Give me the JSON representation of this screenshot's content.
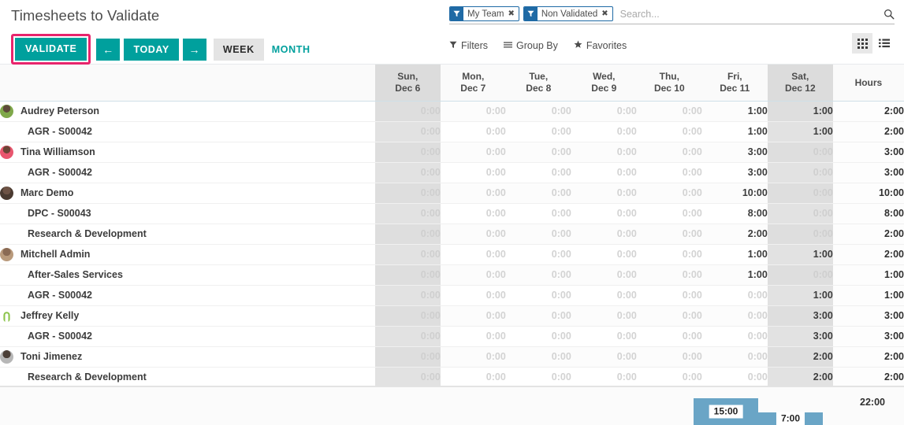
{
  "header": {
    "title": "Timesheets to Validate",
    "validate_label": "VALIDATE",
    "prev_label": "←",
    "today_label": "TODAY",
    "next_label": "→",
    "week_label": "WEEK",
    "month_label": "MONTH"
  },
  "search": {
    "placeholder": "Search...",
    "value": "",
    "facets": [
      {
        "label": "My Team",
        "close": "✖"
      },
      {
        "label": "Non Validated",
        "close": "✖"
      }
    ],
    "filters_label": "Filters",
    "group_by_label": "Group By",
    "favorites_label": "Favorites"
  },
  "columns": {
    "name_header": "",
    "days": [
      {
        "dow": "Sun,",
        "date": "Dec 6",
        "weekend": true
      },
      {
        "dow": "Mon,",
        "date": "Dec 7",
        "weekend": false
      },
      {
        "dow": "Tue,",
        "date": "Dec 8",
        "weekend": false
      },
      {
        "dow": "Wed,",
        "date": "Dec 9",
        "weekend": false
      },
      {
        "dow": "Thu,",
        "date": "Dec 10",
        "weekend": false
      },
      {
        "dow": "Fri,",
        "date": "Dec 11",
        "weekend": false
      },
      {
        "dow": "Sat,",
        "date": "Dec 12",
        "weekend": true
      }
    ],
    "hours_header": "Hours"
  },
  "rows": [
    {
      "label": "Audrey Peterson",
      "type": "employee",
      "avatar": "photo-green",
      "values": [
        "0:00",
        "0:00",
        "0:00",
        "0:00",
        "0:00",
        "1:00",
        "1:00"
      ],
      "total": "2:00"
    },
    {
      "label": "AGR - S00042",
      "type": "task",
      "avatar": "",
      "values": [
        "0:00",
        "0:00",
        "0:00",
        "0:00",
        "0:00",
        "1:00",
        "1:00"
      ],
      "total": "2:00"
    },
    {
      "label": "Tina Williamson",
      "type": "employee",
      "avatar": "photo-pink",
      "values": [
        "0:00",
        "0:00",
        "0:00",
        "0:00",
        "0:00",
        "3:00",
        "0:00"
      ],
      "total": "3:00"
    },
    {
      "label": "AGR - S00042",
      "type": "task",
      "avatar": "",
      "values": [
        "0:00",
        "0:00",
        "0:00",
        "0:00",
        "0:00",
        "3:00",
        "0:00"
      ],
      "total": "3:00"
    },
    {
      "label": "Marc Demo",
      "type": "employee",
      "avatar": "photo-brown",
      "values": [
        "0:00",
        "0:00",
        "0:00",
        "0:00",
        "0:00",
        "10:00",
        "0:00"
      ],
      "total": "10:00"
    },
    {
      "label": "DPC - S00043",
      "type": "task",
      "avatar": "",
      "values": [
        "0:00",
        "0:00",
        "0:00",
        "0:00",
        "0:00",
        "8:00",
        "0:00"
      ],
      "total": "8:00"
    },
    {
      "label": "Research & Development",
      "type": "task",
      "avatar": "",
      "values": [
        "0:00",
        "0:00",
        "0:00",
        "0:00",
        "0:00",
        "2:00",
        "0:00"
      ],
      "total": "2:00"
    },
    {
      "label": "Mitchell Admin",
      "type": "employee",
      "avatar": "photo-tan",
      "values": [
        "0:00",
        "0:00",
        "0:00",
        "0:00",
        "0:00",
        "1:00",
        "1:00"
      ],
      "total": "2:00"
    },
    {
      "label": "After-Sales Services",
      "type": "task",
      "avatar": "",
      "values": [
        "0:00",
        "0:00",
        "0:00",
        "0:00",
        "0:00",
        "1:00",
        "0:00"
      ],
      "total": "1:00"
    },
    {
      "label": "AGR - S00042",
      "type": "task",
      "avatar": "",
      "values": [
        "0:00",
        "0:00",
        "0:00",
        "0:00",
        "0:00",
        "0:00",
        "1:00"
      ],
      "total": "1:00"
    },
    {
      "label": "Jeffrey Kelly",
      "type": "employee",
      "avatar": "placeholder-green",
      "values": [
        "0:00",
        "0:00",
        "0:00",
        "0:00",
        "0:00",
        "0:00",
        "3:00"
      ],
      "total": "3:00"
    },
    {
      "label": "AGR - S00042",
      "type": "task",
      "avatar": "",
      "values": [
        "0:00",
        "0:00",
        "0:00",
        "0:00",
        "0:00",
        "0:00",
        "3:00"
      ],
      "total": "3:00"
    },
    {
      "label": "Toni Jimenez",
      "type": "employee",
      "avatar": "photo-gray",
      "values": [
        "0:00",
        "0:00",
        "0:00",
        "0:00",
        "0:00",
        "0:00",
        "2:00"
      ],
      "total": "2:00"
    },
    {
      "label": "Research & Development",
      "type": "task",
      "avatar": "",
      "values": [
        "0:00",
        "0:00",
        "0:00",
        "0:00",
        "0:00",
        "0:00",
        "2:00"
      ],
      "total": "2:00"
    }
  ],
  "totals": {
    "days": [
      "",
      "",
      "",
      "",
      "",
      "15:00",
      "7:00"
    ],
    "bar_heights_pct": [
      0,
      0,
      0,
      0,
      0,
      68,
      32
    ],
    "grand_total": "22:00"
  },
  "icons": {
    "funnel": "▼",
    "magnifier": "⌕",
    "filters": "▼",
    "group_by": "≡",
    "favorites": "★",
    "grid_view": "grid",
    "list_view": "list"
  },
  "colors": {
    "accent_teal": "#00a09d",
    "highlight_pink": "#e8246c",
    "facet_blue": "#1f6aa5",
    "bar_blue": "#6aa5c6",
    "weekend_gray": "#dcdcdc"
  }
}
